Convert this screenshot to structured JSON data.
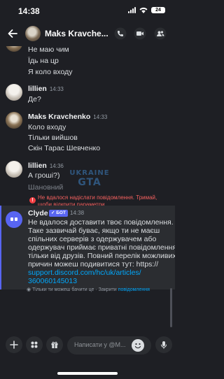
{
  "status_bar": {
    "time": "14:38",
    "battery": "24"
  },
  "header": {
    "title": "Maks Kravche..."
  },
  "messages_top": [
    {
      "text": "Не маю чим"
    },
    {
      "text": "Їдь на цр"
    },
    {
      "text": "Я коло входу"
    }
  ],
  "group_lillien_1": {
    "author": "lillien",
    "time": "14:33",
    "lines": [
      "Де?"
    ]
  },
  "group_maks": {
    "author": "Maks Kravchenko",
    "time": "14:33",
    "lines": [
      "Коло входу",
      "Тільки вийшов",
      "Скін Тарас Шевченко"
    ]
  },
  "group_lillien_2": {
    "author": "lillien",
    "time": "14:36",
    "lines": [
      "А гроші?)",
      "Шановний"
    ]
  },
  "error": {
    "line1": "Не вдалося надіслати повідомлення. Тримай,",
    "line2": "щоби відкрити параметри."
  },
  "watermark": {
    "line1": "UKRAINE",
    "line2": "GTA"
  },
  "clyde": {
    "author": "Clyde",
    "badge": "✓ БОТ",
    "time": "14:38",
    "lines": [
      "Не вдалося доставити твоє повідомлення.",
      "Таке зазвичай буває, якщо ти не маєш",
      "спільних серверів з одержувачем або",
      "одержувач приймає приватні повідомлення",
      "тільки від друзів. Повний перелік можливих",
      "причин можеш подивитися тут: https://",
      "support.discord.com/hc/uk/articles/",
      "360060145013"
    ],
    "footer_text": "Тільки ти можеш бачити це · Закрити",
    "footer_link": "повідомлення"
  },
  "composer": {
    "placeholder": "Написати у @M..."
  },
  "colors": {
    "accent": "#5865f2",
    "error": "#f23f43",
    "link": "#00a8fc",
    "background": "#1e1f24"
  }
}
